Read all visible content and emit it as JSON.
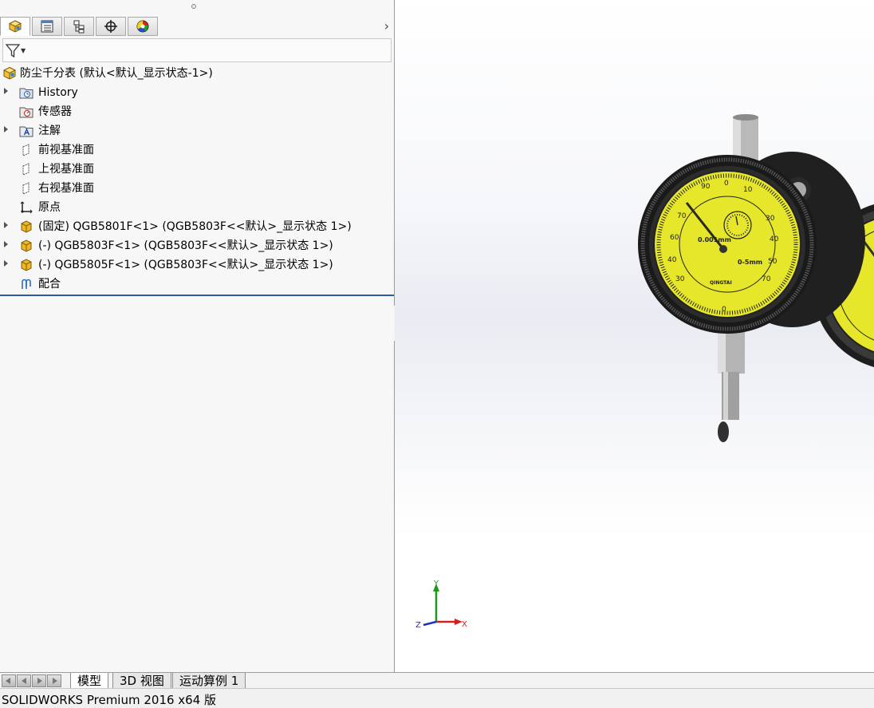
{
  "panel_tabs": [
    {
      "icon": "feature-manager-icon"
    },
    {
      "icon": "property-manager-icon"
    },
    {
      "icon": "configuration-manager-icon"
    },
    {
      "icon": "dimxpert-manager-icon"
    },
    {
      "icon": "display-manager-icon"
    }
  ],
  "tree": {
    "root": {
      "label": "防尘千分表  (默认<默认_显示状态-1>)",
      "icon": "assembly-icon"
    },
    "items": [
      {
        "label": "History",
        "icon": "history-folder-icon",
        "expandable": true
      },
      {
        "label": "传感器",
        "icon": "sensors-folder-icon",
        "expandable": false
      },
      {
        "label": "注解",
        "icon": "annotations-folder-icon",
        "expandable": true
      },
      {
        "label": "前视基准面",
        "icon": "plane-icon",
        "expandable": false
      },
      {
        "label": "上视基准面",
        "icon": "plane-icon",
        "expandable": false
      },
      {
        "label": "右视基准面",
        "icon": "plane-icon",
        "expandable": false
      },
      {
        "label": "原点",
        "icon": "origin-icon",
        "expandable": false
      },
      {
        "label": "(固定) QGB5801F<1> (QGB5803F<<默认>_显示状态 1>)",
        "icon": "part-icon",
        "expandable": true
      },
      {
        "label": "(-) QGB5803F<1> (QGB5803F<<默认>_显示状态 1>)",
        "icon": "part-icon",
        "expandable": true
      },
      {
        "label": "(-) QGB5805F<1> (QGB5803F<<默认>_显示状态 1>)",
        "icon": "part-icon",
        "expandable": true
      },
      {
        "label": "配合",
        "icon": "mates-icon",
        "expandable": false
      }
    ]
  },
  "viewport": {
    "triad": {
      "x_label": "X",
      "y_label": "Y",
      "z_label": "Z"
    },
    "dial_main": {
      "unit_text": "0.001mm",
      "range_text": "0-5mm",
      "brand_text": "QINGTAI"
    },
    "colors": {
      "dial_face": "#e6e62a",
      "bezel": "#2a2a2a",
      "x_axis": "#d02020",
      "y_axis": "#1a9a1a",
      "z_axis": "#2030c0"
    }
  },
  "bottom_tabs": [
    "模型",
    "3D 视图",
    "运动算例 1"
  ],
  "status": {
    "text": "SOLIDWORKS Premium 2016 x64 版"
  }
}
